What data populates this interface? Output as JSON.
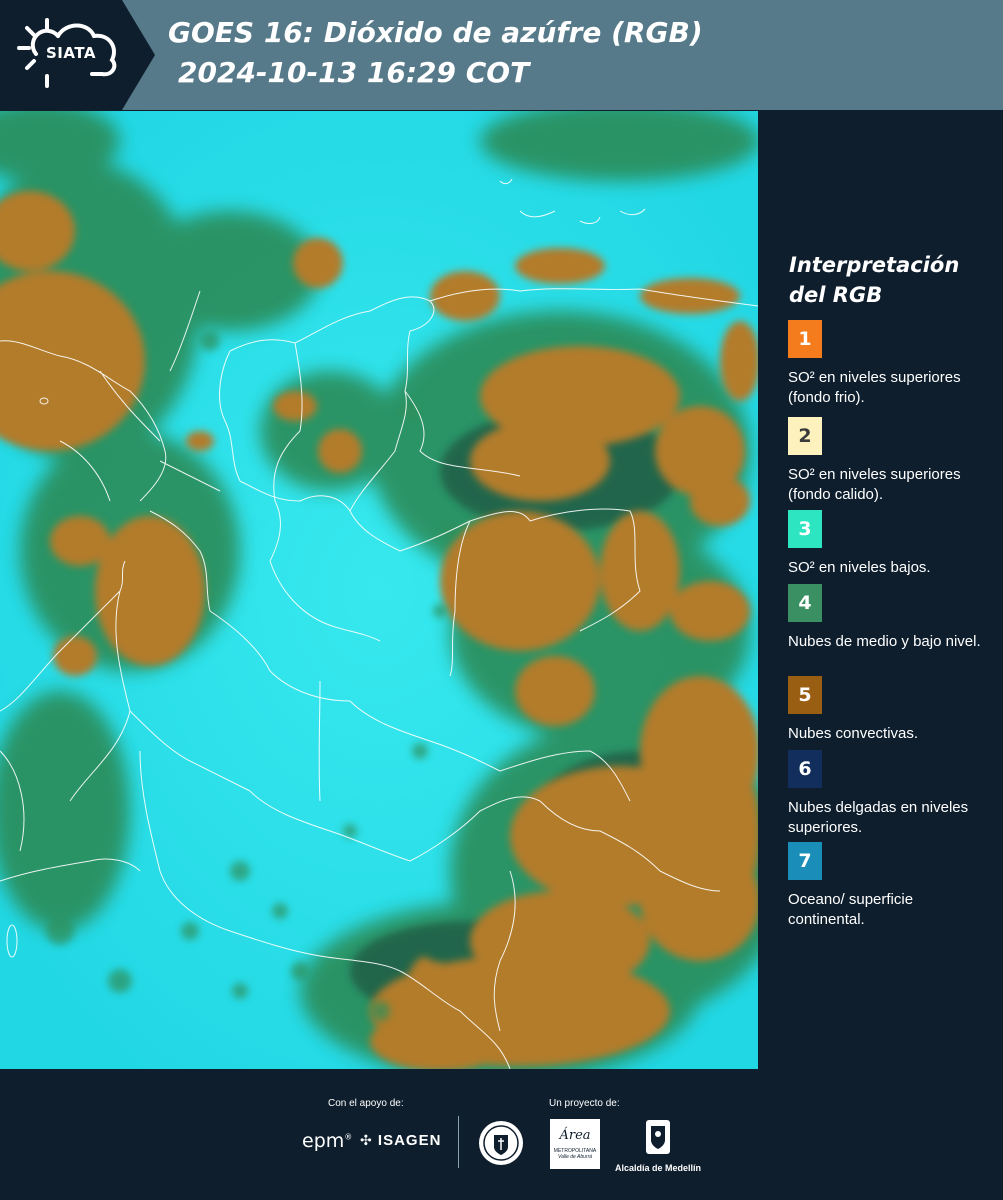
{
  "header": {
    "logo_text": "SIATA",
    "title_line1": "GOES 16: Dióxido de azúfre (RGB)",
    "title_line2": "2024-10-13 16:29 COT"
  },
  "legend": {
    "title_line1": "Interpretación",
    "title_line2": "del RGB",
    "items": [
      {
        "number": "1",
        "text": "SO² en niveles superiores (fondo frio).",
        "color": "#f47c1c",
        "text_color": "#ffffff"
      },
      {
        "number": "2",
        "text": "SO² en niveles superiores (fondo calido).",
        "color": "#fdf2be",
        "text_color": "#3b3b3b"
      },
      {
        "number": "3",
        "text": "SO² en niveles bajos.",
        "color": "#2de6c1",
        "text_color": "#ffffff"
      },
      {
        "number": "4",
        "text": "Nubes de medio y bajo nivel.",
        "color": "#3a8f63",
        "text_color": "#ffffff"
      },
      {
        "number": "5",
        "text": "Nubes convectivas.",
        "color": "#9a5e12",
        "text_color": "#ffffff"
      },
      {
        "number": "6",
        "text": "Nubes delgadas en niveles superiores.",
        "color": "#112e5c",
        "text_color": "#ffffff"
      },
      {
        "number": "7",
        "text": "Oceano/ superficie continental.",
        "color": "#1a8db8",
        "text_color": "#ffffff"
      }
    ]
  },
  "footer": {
    "support_label": "Con el apoyo de:",
    "project_label": "Un proyecto de:",
    "logo_epm": "epm",
    "logo_isagen": "ISAGEN",
    "logo_area_top": "Área",
    "logo_area_mid": "METROPOLITANA",
    "logo_area_bottom": "Valle de Aburrá",
    "logo_alcaldia": "Alcaldía de Medellín"
  },
  "map": {
    "colors": {
      "ocean_cyan": "#2fe3ea",
      "convective_brown": "#b07a2a",
      "midlevel_green": "#2f8f5a",
      "dark_edge": "#1d4a3a",
      "border_white": "#ffffff"
    }
  }
}
